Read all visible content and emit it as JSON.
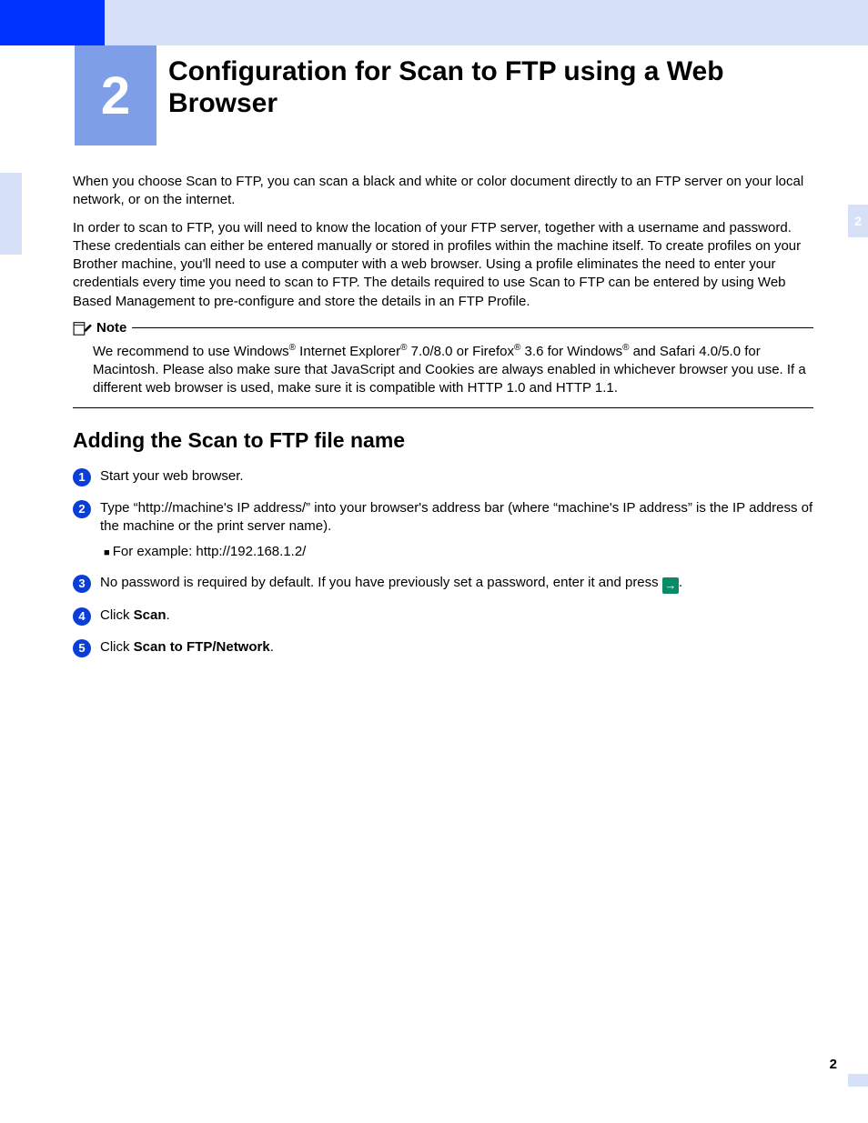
{
  "chapter": {
    "number": "2",
    "title": "Configuration for Scan to FTP using a Web Browser"
  },
  "sideTab": "2",
  "para1": "When you choose Scan to FTP, you can scan a black and white or color document directly to an FTP server on your local network, or on the internet.",
  "para2": "In order to scan to FTP, you will need to know the location of your FTP server, together with a username and password. These credentials can either be entered manually or stored in profiles within the machine itself. To create profiles on your Brother machine, you'll need to use a computer with a web browser. Using a profile eliminates the need to enter your credentials every time you need to scan to FTP. The details required to use Scan to FTP can be entered by using Web Based Management to pre-configure and store the details in an FTP Profile.",
  "note": {
    "label": "Note",
    "t1": "We recommend to use Windows",
    "t2": " Internet Explorer",
    "t3": " 7.0/8.0 or Firefox",
    "t4": " 3.6 for Windows",
    "t5": " and Safari 4.0/5.0 for Macintosh. Please also make sure that JavaScript and Cookies are always enabled in whichever browser you use. If a different web browser is used, make sure it is compatible with HTTP 1.0 and HTTP 1.1."
  },
  "section": "Adding the Scan to FTP file name",
  "steps": {
    "s1": "Start your web browser.",
    "s2": "Type “http://machine's IP address/” into your browser's address bar (where “machine's IP address” is the IP address of the machine or the print server name).",
    "s2sub": "For example: http://192.168.1.2/",
    "s3a": "No password is required by default. If you have previously set a password, enter it and press ",
    "s3b": ".",
    "s4a": "Click ",
    "s4b": "Scan",
    "s4c": ".",
    "s5a": "Click ",
    "s5b": "Scan to FTP/Network",
    "s5c": "."
  },
  "pageNumber": "2"
}
